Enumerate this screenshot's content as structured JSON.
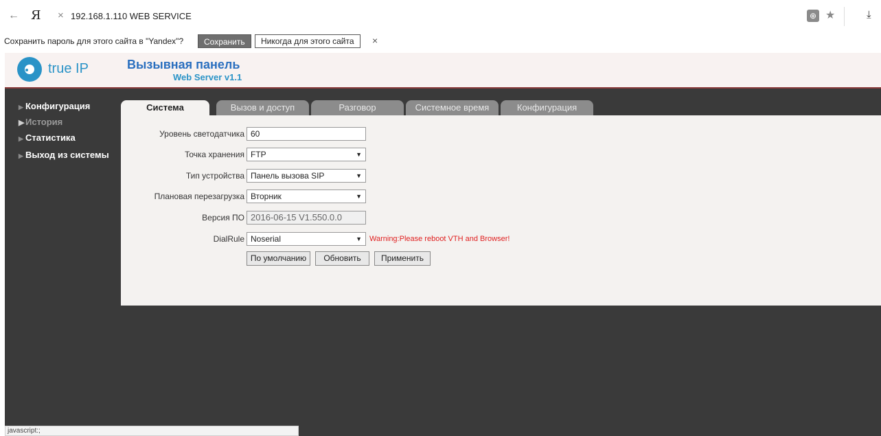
{
  "browser": {
    "back_icon": "←",
    "logo": "Я",
    "close_icon": "×",
    "url": "192.168.1.110  WEB SERVICE",
    "star_icon": "★",
    "download_icon": "⤓"
  },
  "password_bar": {
    "prompt": "Сохранить пароль для этого сайта в \"Yandex\"?",
    "save_label": "Сохранить",
    "never_label": "Никогда для этого сайта",
    "close_icon": "×"
  },
  "header": {
    "logo_text": "true IP",
    "title": "Вызывная панель",
    "subtitle": "Web Server v1.1",
    "brand_color": "#2a93c7"
  },
  "sidebar": {
    "items": [
      {
        "label": "Конфигурация"
      },
      {
        "label": "История"
      },
      {
        "label": "Статистика"
      },
      {
        "label": "Выход из системы"
      }
    ]
  },
  "tabs": [
    {
      "label": "Система",
      "active": true
    },
    {
      "label": "Вызов и доступ",
      "active": false
    },
    {
      "label": "Разговор",
      "active": false
    },
    {
      "label": "Системное время",
      "active": false
    },
    {
      "label": "Конфигурация",
      "active": false
    }
  ],
  "form": {
    "light_sensor": {
      "label": "Уровень светодатчика",
      "value": "60"
    },
    "storage": {
      "label": "Точка хранения",
      "value": "FTP"
    },
    "device_type": {
      "label": "Тип устройства",
      "value": "Панель вызова SIP"
    },
    "reboot": {
      "label": "Плановая перезагрузка",
      "value": "Вторник"
    },
    "version": {
      "label": "Версия ПО",
      "value": "2016-06-15 V1.550.0.0"
    },
    "dialrule": {
      "label": "DialRule",
      "value": "Noserial",
      "warning": "Warning:Please reboot VTH and Browser!"
    },
    "buttons": {
      "default": "По умолчанию",
      "refresh": "Обновить",
      "apply": "Применить"
    }
  },
  "status_bar": {
    "text": "javascript:;"
  }
}
